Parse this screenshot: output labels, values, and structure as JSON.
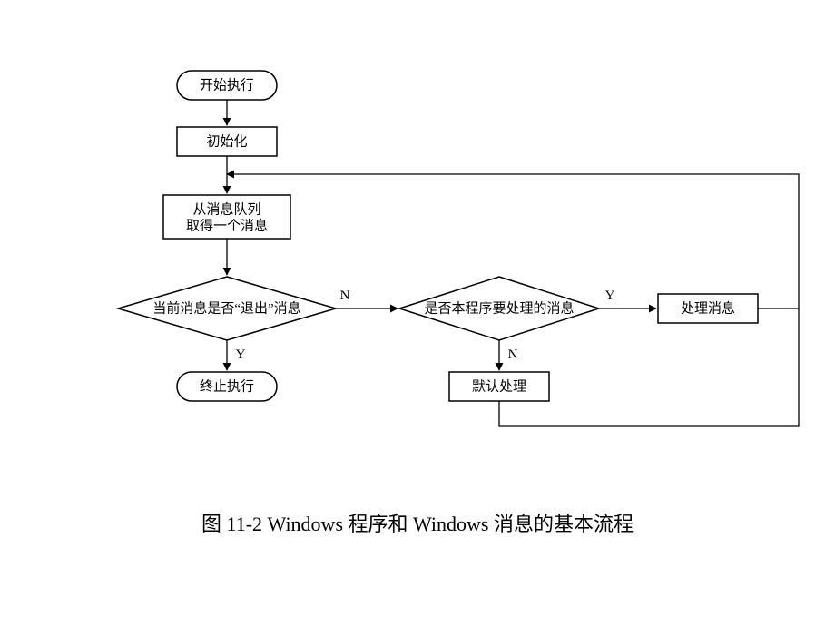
{
  "caption": "图 11-2   Windows 程序和 Windows 消息的基本流程",
  "nodes": {
    "start": {
      "label": "开始执行"
    },
    "init": {
      "label": "初始化"
    },
    "getmsg_l1": "从消息队列",
    "getmsg_l2": "取得一个消息",
    "isquit": {
      "label": "当前消息是否“退出”消息"
    },
    "terminate": {
      "label": "终止执行"
    },
    "ishandled": {
      "label": "是否本程序要处理的消息"
    },
    "process": {
      "label": "处理消息"
    },
    "default": {
      "label": "默认处理"
    }
  },
  "edges": {
    "isquit_N": "N",
    "isquit_Y": "Y",
    "ishandled_Y": "Y",
    "ishandled_N": "N"
  }
}
